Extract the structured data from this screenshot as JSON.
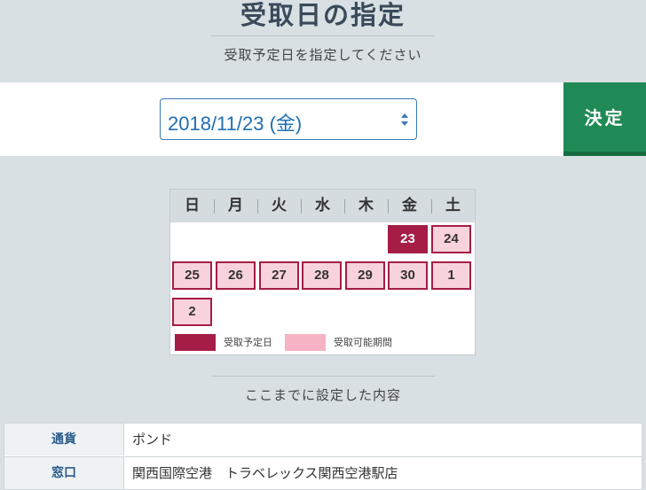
{
  "header": {
    "title": "受取日の指定",
    "subtitle": "受取予定日を指定してください"
  },
  "date_picker": {
    "selected_value": "2018/11/23 (金)",
    "decide_label": "決定"
  },
  "calendar": {
    "weekdays": [
      "日",
      "月",
      "火",
      "水",
      "木",
      "金",
      "土"
    ],
    "selected_day": "23",
    "available_days": [
      "24",
      "25",
      "26",
      "27",
      "28",
      "29",
      "30",
      "1",
      "2"
    ],
    "legend": {
      "selected_label": "受取予定日",
      "available_label": "受取可能期間"
    },
    "colors": {
      "selected": "#a51d45",
      "available": "#f9d3dc"
    }
  },
  "summary": {
    "title": "ここまでに設定した内容",
    "rows": [
      {
        "label": "通貨",
        "value": "ポンド"
      },
      {
        "label": "窓口",
        "value": "関西国際空港　トラベレックス関西空港駅店"
      }
    ]
  },
  "colors": {
    "accent_green": "#1f8a55",
    "select_blue": "#1f6fb5"
  }
}
